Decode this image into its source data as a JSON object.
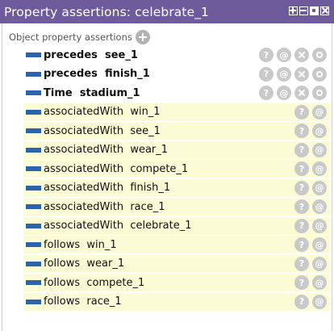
{
  "window": {
    "title": "Property assertions: celebrate_1"
  },
  "section": {
    "label": "Object property assertions"
  },
  "asserted": [
    {
      "text": "precedes  see_1"
    },
    {
      "text": "precedes  finish_1"
    },
    {
      "text": "Time  stadium_1"
    }
  ],
  "inferred": [
    {
      "text": "associatedWith  win_1"
    },
    {
      "text": "associatedWith  see_1"
    },
    {
      "text": "associatedWith  wear_1"
    },
    {
      "text": "associatedWith  compete_1"
    },
    {
      "text": "associatedWith  finish_1"
    },
    {
      "text": "associatedWith  race_1"
    },
    {
      "text": "associatedWith  celebrate_1"
    },
    {
      "text": "follows  win_1"
    },
    {
      "text": "follows  wear_1"
    },
    {
      "text": "follows  compete_1"
    },
    {
      "text": "follows  race_1"
    }
  ],
  "buttons": {
    "explain": "?",
    "annotate": "@"
  },
  "colors": {
    "title_bar": "#6e5b9c",
    "property_bullet": "#2d63ad",
    "inferred_row_bg": "#fbfbd6",
    "button": "#c9c9c9"
  }
}
